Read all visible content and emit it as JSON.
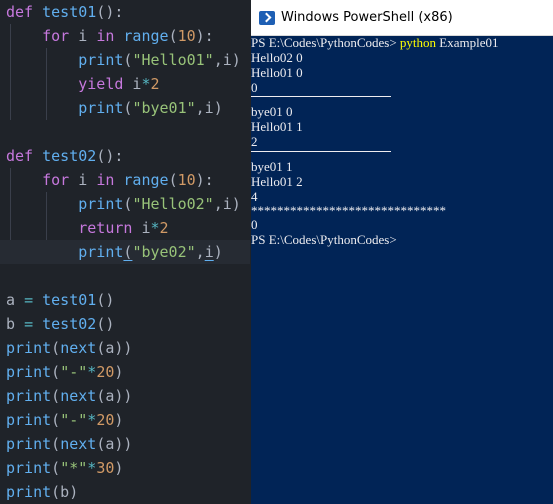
{
  "editor": {
    "lines": [
      [
        "def ",
        "test01",
        "():"
      ],
      [
        "    ",
        "for",
        " i ",
        "in",
        " ",
        "range",
        "(",
        "10",
        "):"
      ],
      [
        "        ",
        "print",
        "(",
        "\"Hello01\"",
        ",i)"
      ],
      [
        "        ",
        "yield",
        " i",
        "*",
        "2"
      ],
      [
        "        ",
        "print",
        "(",
        "\"bye01\"",
        ",i)"
      ],
      [
        ""
      ],
      [
        "def ",
        "test02",
        "():"
      ],
      [
        "    ",
        "for",
        " i ",
        "in",
        " ",
        "range",
        "(",
        "10",
        "):"
      ],
      [
        "        ",
        "print",
        "(",
        "\"Hello02\"",
        ",i)"
      ],
      [
        "        ",
        "return",
        " i",
        "*",
        "2"
      ],
      [
        "        ",
        "print",
        "(",
        "\"bye02\"",
        ",",
        "i",
        ")"
      ],
      [
        ""
      ],
      [
        "a ",
        "=",
        " ",
        "test01",
        "()"
      ],
      [
        "b ",
        "=",
        " ",
        "test02",
        "()"
      ],
      [
        "print",
        "(",
        "next",
        "(a))"
      ],
      [
        "print",
        "(",
        "\"-\"",
        "*",
        "20",
        ")"
      ],
      [
        "print",
        "(",
        "next",
        "(a))"
      ],
      [
        "print",
        "(",
        "\"-\"",
        "*",
        "20",
        ")"
      ],
      [
        "print",
        "(",
        "next",
        "(a))"
      ],
      [
        "print",
        "(",
        "\"*\"",
        "*",
        "30",
        ")"
      ],
      [
        "print",
        "(b)"
      ]
    ]
  },
  "powershell": {
    "title": "Windows PowerShell (x86)",
    "prompt": "PS E:\\Codes\\PythonCodes>",
    "command_bin": "python",
    "command_arg": "Example01",
    "output": [
      "Hello02 0",
      "Hello01 0",
      "0",
      "",
      "bye01 0",
      "Hello01 1",
      "2",
      "",
      "bye01 1",
      "Hello01 2",
      "4",
      "******************************",
      "0"
    ],
    "final_prompt": "PS E:\\Codes\\PythonCodes>"
  },
  "colors": {
    "editor_bg": "#1f2329",
    "ps_bg": "#012456",
    "keyword": "#c678dd",
    "function": "#61afef",
    "string": "#98c379",
    "number": "#d19a66"
  }
}
